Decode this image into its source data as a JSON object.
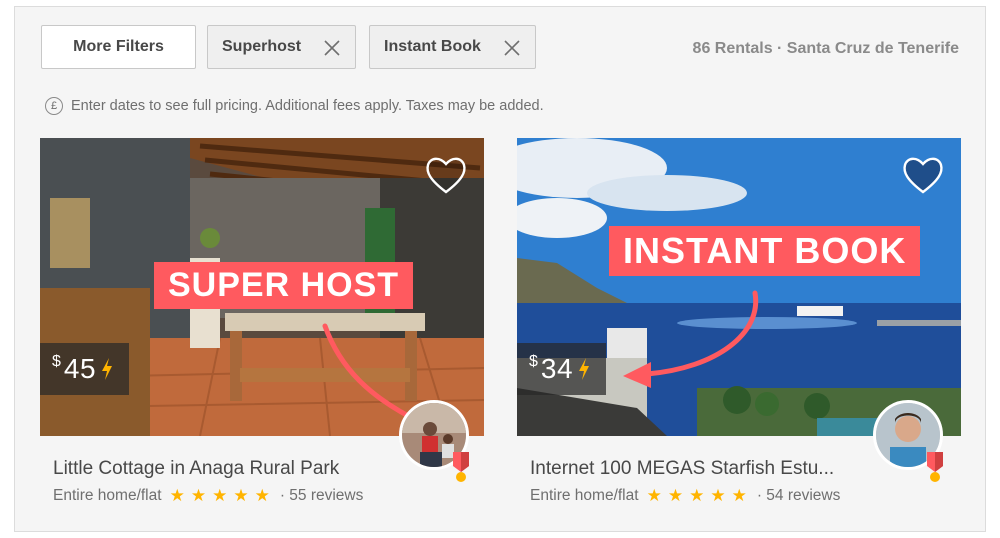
{
  "filters": {
    "more_filters": "More Filters",
    "superhost": "Superhost",
    "instant_book": "Instant Book"
  },
  "rentals_summary": "86 Rentals · Santa Cruz de Tenerife",
  "pricing_note": "Enter dates to see full pricing. Additional fees apply. Taxes may be added.",
  "pricing_icon_symbol": "£",
  "listings": [
    {
      "currency": "$",
      "price": "45",
      "instant_book_icon": "lightning-bolt-icon",
      "annotation": "SUPER HOST",
      "title": "Little Cottage in Anaga Rural Park",
      "room_type": "Entire home/flat",
      "stars": 5,
      "reviews": "· 55 reviews",
      "heart_filled": false
    },
    {
      "currency": "$",
      "price": "34",
      "instant_book_icon": "lightning-bolt-icon",
      "annotation": "INSTANT BOOK",
      "title": "Internet 100 MEGAS Starfish Estu...",
      "room_type": "Entire home/flat",
      "stars": 5,
      "reviews": "· 54 reviews",
      "heart_filled": true
    }
  ],
  "colors": {
    "accent": "#ff5a5f",
    "star": "#ffb400",
    "bolt": "#ffb400",
    "text": "#484848"
  }
}
